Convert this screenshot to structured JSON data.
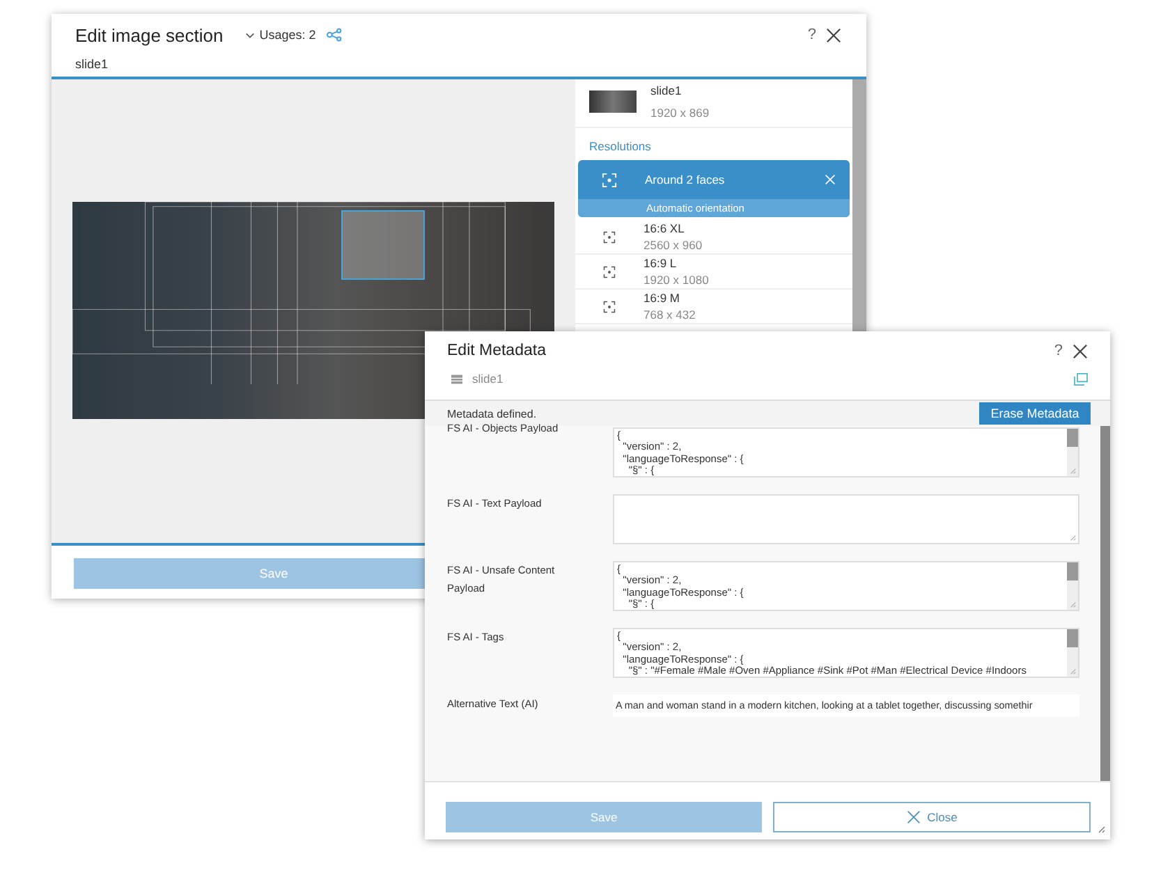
{
  "image_dialog": {
    "title": "Edit image section",
    "usages": "Usages: 2",
    "help": "?",
    "subtitle": "slide1",
    "image": {
      "name": "slide1",
      "size": "1920 x 869"
    },
    "resolutions_heading": "Resolutions",
    "resolutions": [
      {
        "name": "Around 2 faces",
        "detail": "Automatic orientation",
        "selected": true
      },
      {
        "name": "16:6 XL",
        "detail": "2560 x 960",
        "selected": false
      },
      {
        "name": "16:9 L",
        "detail": "1920 x 1080",
        "selected": false
      },
      {
        "name": "16:9 M",
        "detail": "768 x 432",
        "selected": false
      }
    ],
    "save": "Save"
  },
  "metadata_dialog": {
    "title": "Edit Metadata",
    "help": "?",
    "item": "slide1",
    "status": "Metadata defined.",
    "erase": "Erase Metadata",
    "fields": [
      {
        "label": "FS AI - Objects Payload",
        "kind": "textarea",
        "value": "{\n  \"version\" : 2,\n  \"languageToResponse\" : {\n    \"§\" : {"
      },
      {
        "label": "FS AI - Text Payload",
        "kind": "textarea"
      },
      {
        "label": "FS AI - Unsafe Content Payload",
        "kind": "textarea",
        "value": "{\n  \"version\" : 2,\n  \"languageToResponse\" : {\n    \"§\" : {"
      },
      {
        "label": "FS AI - Tags",
        "kind": "textarea",
        "value": "{\n  \"version\" : 2,\n  \"languageToResponse\" : {\n    \"§\" : \"#Female #Male #Oven #Appliance #Sink #Pot #Man #Electrical Device #Indoors"
      },
      {
        "label": "Alternative Text (AI)",
        "kind": "text",
        "value": "A man and woman stand in a modern kitchen, looking at a tablet together, discussing somethir"
      }
    ],
    "save": "Save",
    "close": "Close"
  }
}
